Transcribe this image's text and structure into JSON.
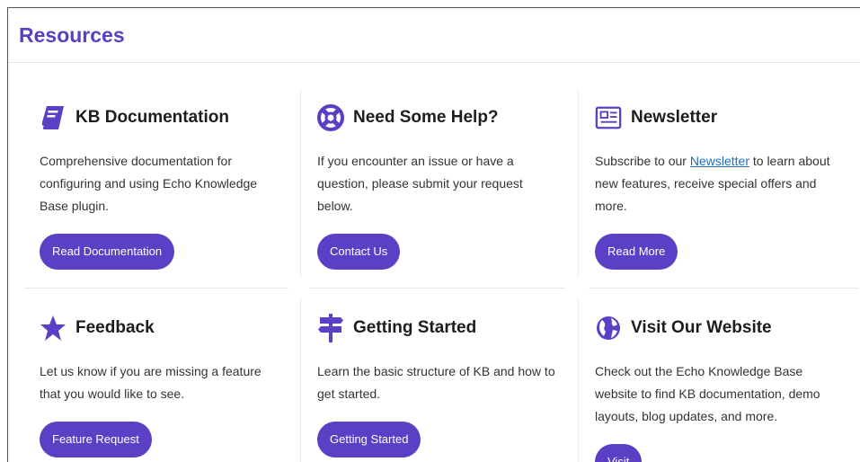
{
  "header": {
    "title": "Resources"
  },
  "cards": [
    {
      "icon": "book-icon",
      "title": "KB Documentation",
      "text": "Comprehensive documentation for configuring and using Echo Knowledge Base plugin.",
      "button": "Read Documentation"
    },
    {
      "icon": "lifebuoy-icon",
      "title": "Need Some Help?",
      "text": "If you encounter an issue or have a question, please submit your request below.",
      "button": "Contact Us"
    },
    {
      "icon": "newspaper-icon",
      "title": "Newsletter",
      "text_before": "Subscribe to our",
      "link": "Newsletter",
      "text_after": "to learn about new features, receive special offers and more.",
      "button": "Read More"
    },
    {
      "icon": "star-icon",
      "title": "Feedback",
      "text": "Let us know if you are missing a feature that you would like to see.",
      "button": "Feature Request"
    },
    {
      "icon": "signpost-icon",
      "title": "Getting Started",
      "text": "Learn the basic structure of KB and how to get started.",
      "button": "Getting Started"
    },
    {
      "icon": "globe-icon",
      "title": "Visit Our Website",
      "text": "Check out the Echo Knowledge Base website to find KB documentation, demo layouts, blog updates, and more.",
      "button": "Visit"
    }
  ],
  "colors": {
    "accent": "#5b3fc4",
    "link": "#1e6dbf"
  }
}
